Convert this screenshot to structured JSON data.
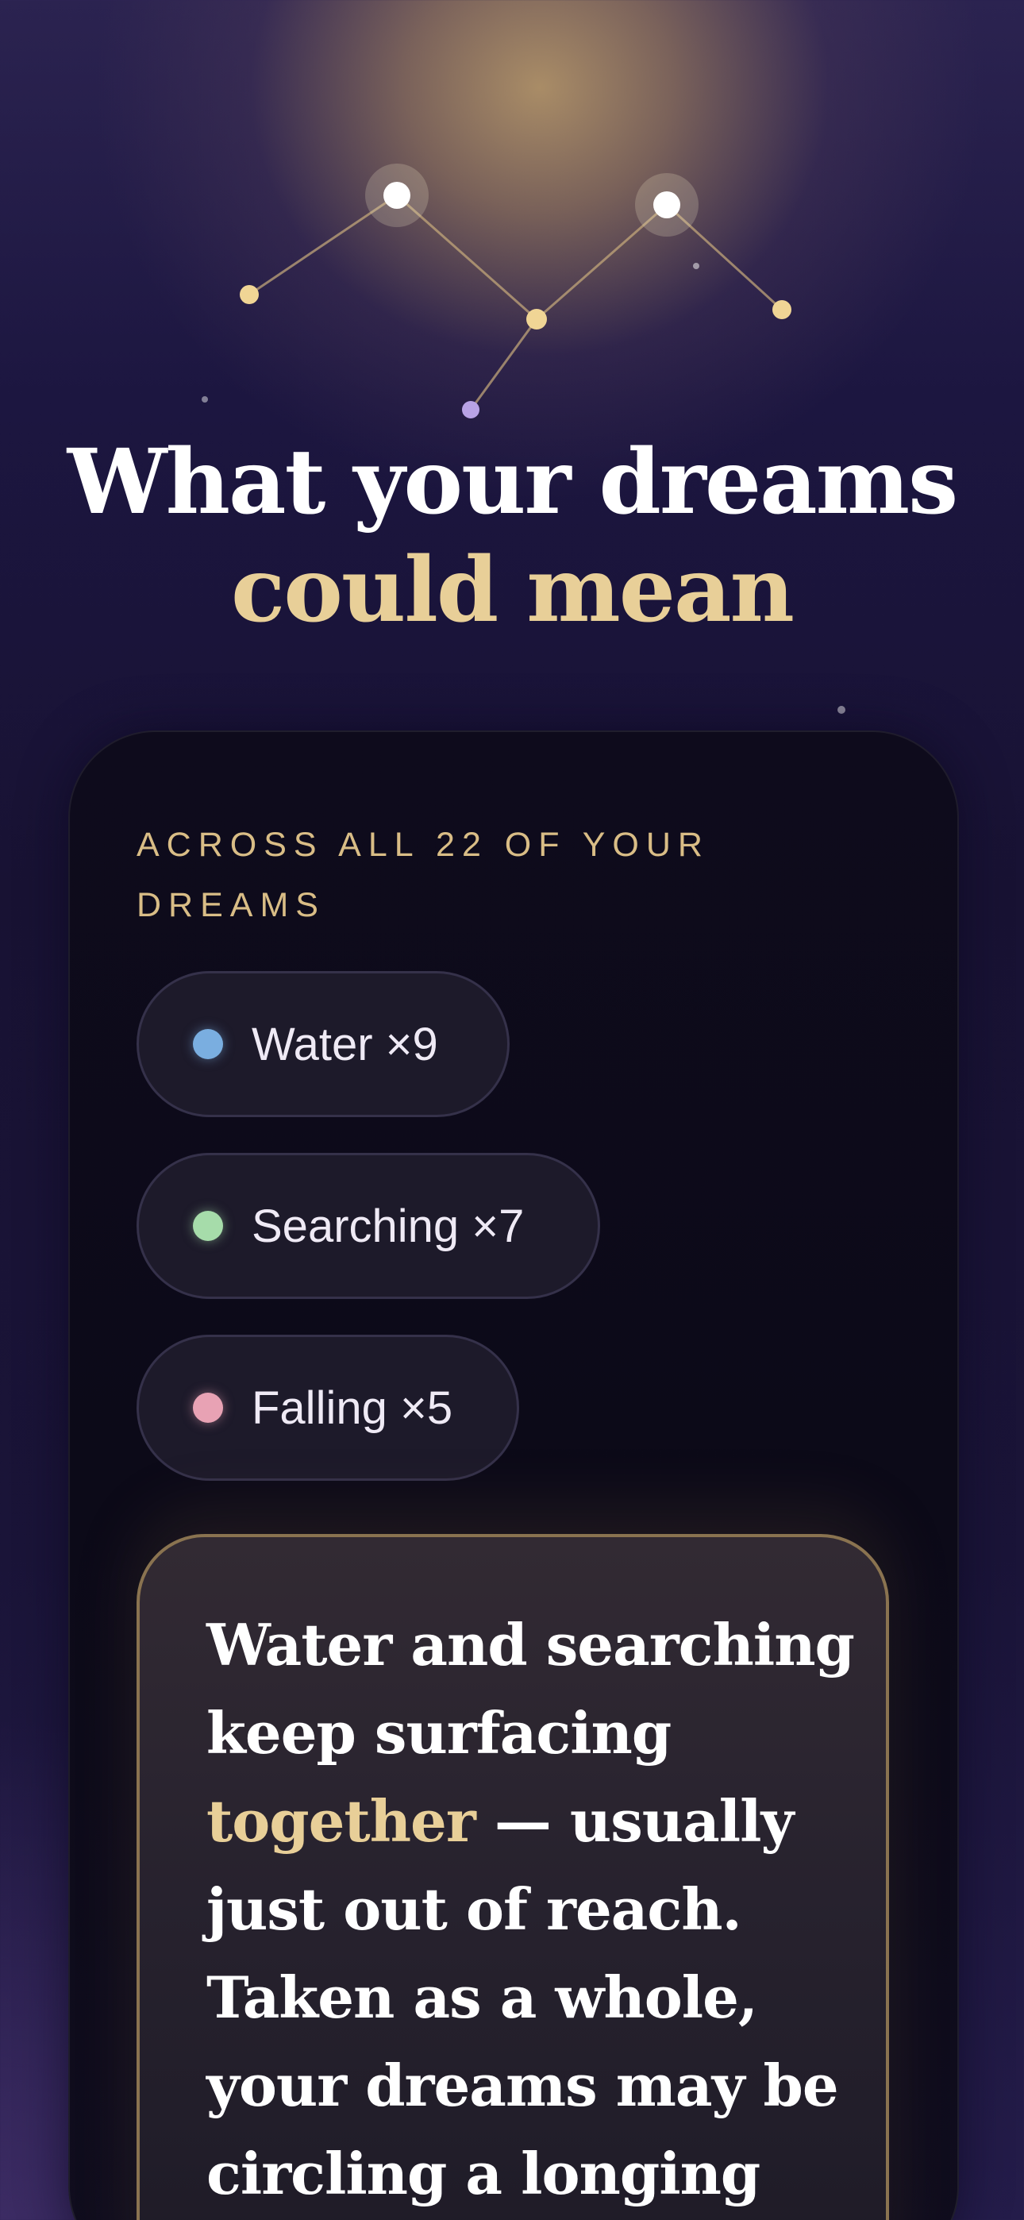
{
  "headline": {
    "line1": "What your dreams",
    "line2": "could mean"
  },
  "card": {
    "eyebrow": "Across all 22 of your dreams",
    "themes": [
      {
        "label": "Water ×9",
        "color": "#7aaee0"
      },
      {
        "label": "Searching ×7",
        "color": "#a6dcaa"
      },
      {
        "label": "Falling ×5",
        "color": "#e8a2b4"
      }
    ],
    "insight": {
      "part1": "Water and searching keep surfacing ",
      "highlight": "together",
      "part2": " — usually just out of reach. Taken as a whole, your dreams may be circling a longing you"
    }
  },
  "colors": {
    "accent_gold": "#e8cf98",
    "eyebrow_gold": "#d9bd86",
    "quote_border": "#8a7350"
  }
}
